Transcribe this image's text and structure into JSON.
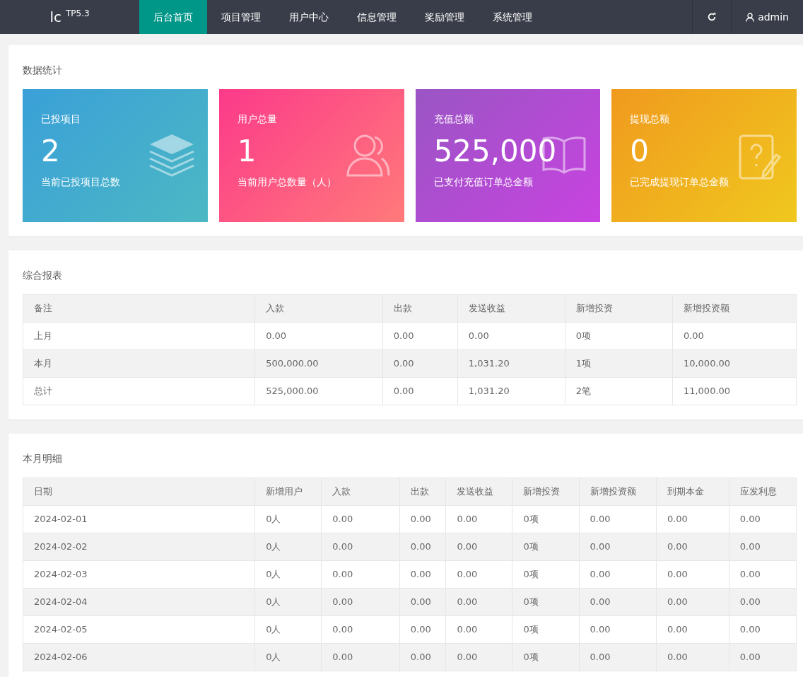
{
  "navbar": {
    "logo": "lc",
    "version": "TP5.3",
    "menu": [
      {
        "label": "后台首页",
        "selected": true
      },
      {
        "label": "项目管理",
        "selected": false
      },
      {
        "label": "用户中心",
        "selected": false
      },
      {
        "label": "信息管理",
        "selected": false
      },
      {
        "label": "奖励管理",
        "selected": false
      },
      {
        "label": "系统管理",
        "selected": false
      }
    ],
    "user": "admin"
  },
  "stats": {
    "title": "数据统计",
    "cards": [
      {
        "title": "已投项目",
        "value": "2",
        "caption": "当前已投项目总数",
        "kind": "layers"
      },
      {
        "title": "用户总量",
        "value": "1",
        "caption": "当前用户总数量（人）",
        "kind": "users"
      },
      {
        "title": "充值总额",
        "value": "525,000",
        "caption": "已支付充值订单总金额",
        "kind": "book"
      },
      {
        "title": "提现总额",
        "value": "0",
        "caption": "已完成提现订单总金额",
        "kind": "note"
      }
    ]
  },
  "report": {
    "title": "综合报表",
    "columns": [
      "备注",
      "入款",
      "出款",
      "发送收益",
      "新增投资",
      "新增投资额"
    ],
    "rows": [
      [
        "上月",
        "0.00",
        "0.00",
        "0.00",
        "0项",
        "0.00"
      ],
      [
        "本月",
        "500,000.00",
        "0.00",
        "1,031.20",
        "1项",
        "10,000.00"
      ],
      [
        "总计",
        "525,000.00",
        "0.00",
        "1,031.20",
        "2笔",
        "11,000.00"
      ]
    ]
  },
  "monthly": {
    "title": "本月明细",
    "columns": [
      "日期",
      "新增用户",
      "入款",
      "出款",
      "发送收益",
      "新增投资",
      "新增投资额",
      "到期本金",
      "应发利息"
    ],
    "rows": [
      [
        "2024-02-01",
        "0人",
        "0.00",
        "0.00",
        "0.00",
        "0项",
        "0.00",
        "0.00",
        "0.00"
      ],
      [
        "2024-02-02",
        "0人",
        "0.00",
        "0.00",
        "0.00",
        "0项",
        "0.00",
        "0.00",
        "0.00"
      ],
      [
        "2024-02-03",
        "0人",
        "0.00",
        "0.00",
        "0.00",
        "0项",
        "0.00",
        "0.00",
        "0.00"
      ],
      [
        "2024-02-04",
        "0人",
        "0.00",
        "0.00",
        "0.00",
        "0项",
        "0.00",
        "0.00",
        "0.00"
      ],
      [
        "2024-02-05",
        "0人",
        "0.00",
        "0.00",
        "0.00",
        "0项",
        "0.00",
        "0.00",
        "0.00"
      ],
      [
        "2024-02-06",
        "0人",
        "0.00",
        "0.00",
        "0.00",
        "0项",
        "0.00",
        "0.00",
        "0.00"
      ]
    ]
  }
}
